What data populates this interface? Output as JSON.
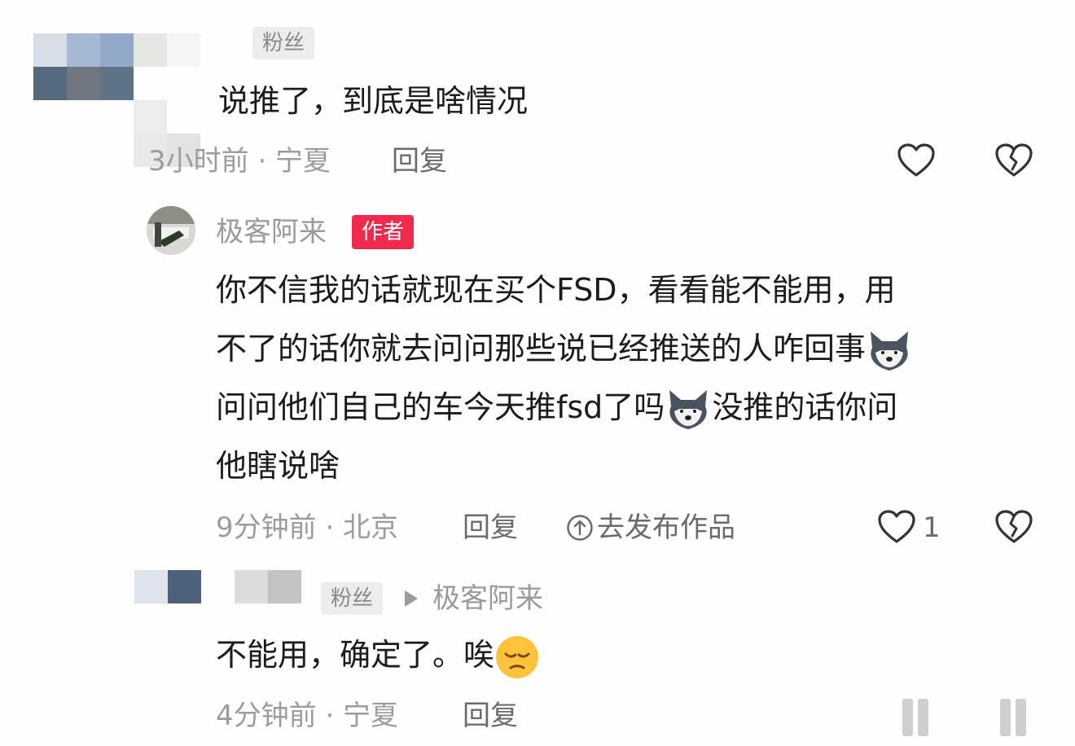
{
  "comment1": {
    "badge": "粉丝",
    "text": "说推了，到底是啥情况",
    "meta": "3小时前 · 宁夏",
    "reply": "回复"
  },
  "author_reply": {
    "username": "极客阿来",
    "badge": "作者",
    "lines": [
      "你不信我的话就现在买个FSD，看看能不能用，用",
      "不了的话你就去问问那些说已经推送的人咋回事",
      "问问他们自己的车今天推fsd了吗",
      "没推的话你问",
      "他瞎说啥"
    ],
    "meta": "9分钟前 · 北京",
    "reply": "回复",
    "publish": "去发布作品",
    "likes": "1"
  },
  "comment3": {
    "badge": "粉丝",
    "reply_to": "极客阿来",
    "text": "不能用，确定了。唉",
    "meta": "4分钟前 · 宁夏",
    "reply": "回复"
  },
  "colors": {
    "author_badge": "#f02a4c",
    "username": "#9a9a9a",
    "meta": "#9c9c9c",
    "body": "#1b1b1b"
  },
  "icons": [
    "heart-icon",
    "broken-heart-icon",
    "upload-icon",
    "wolf-emoji",
    "pensive-emoji",
    "play-triangle-icon"
  ]
}
